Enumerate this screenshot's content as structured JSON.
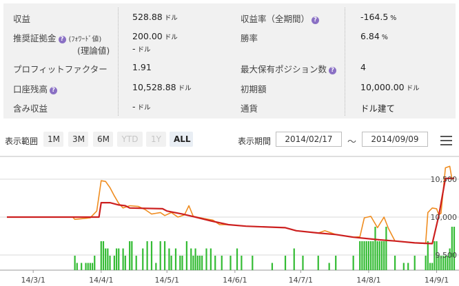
{
  "stats": {
    "rows": [
      {
        "left": {
          "label": "収益",
          "value": "528.88",
          "unit": "ドル"
        },
        "right": {
          "label": "収益率（全期間）",
          "help": true,
          "value": "-164.5",
          "unit": "%"
        }
      },
      {
        "left": {
          "label": "推奨証拠金",
          "help": true,
          "sub1": "(ﾌｫﾜｰﾄﾞ値)",
          "sub2": "(理論値)",
          "value": "200.00",
          "unit": "ドル",
          "value2": "-",
          "unit2": "ドル"
        },
        "right": {
          "label": "勝率",
          "value": "6.84",
          "unit": "%"
        }
      },
      {
        "left": {
          "label": "プロフィットファクター",
          "value": "1.91"
        },
        "right": {
          "label": "最大保有ポジション数",
          "help": true,
          "value": "4"
        }
      },
      {
        "left": {
          "label": "口座残高",
          "help": true,
          "value": "10,528.88",
          "unit": "ドル"
        },
        "right": {
          "label": "初期額",
          "value": "10,000.00",
          "unit": "ドル"
        }
      },
      {
        "left": {
          "label": "含み収益",
          "value": "-",
          "unit": "ドル"
        },
        "right": {
          "label": "通貨",
          "value": "ドル建て"
        }
      }
    ],
    "help_glyph": "?"
  },
  "controls": {
    "range_label": "表示範囲",
    "ranges": [
      {
        "label": "1M",
        "state": "normal"
      },
      {
        "label": "3M",
        "state": "normal"
      },
      {
        "label": "6M",
        "state": "normal"
      },
      {
        "label": "YTD",
        "state": "disabled"
      },
      {
        "label": "1Y",
        "state": "disabled"
      },
      {
        "label": "ALL",
        "state": "active"
      }
    ],
    "period_label": "表示期間",
    "date_from": "2014/02/17",
    "tilde": "〜",
    "date_to": "2014/09/09",
    "menu_icon": "hamburger-menu-icon"
  },
  "chart_data": {
    "type": "line",
    "x_range": [
      "2014-02-17",
      "2014-09-09"
    ],
    "x_ticks": [
      "14/3/1",
      "14/4/1",
      "14/5/1",
      "14/6/1",
      "14/7/1",
      "14/8/1",
      "14/9/1"
    ],
    "y_ticks": [
      {
        "value": 10500,
        "label": "10,500"
      },
      {
        "value": 10000,
        "label": "10,000"
      },
      {
        "value": 9500,
        "label": "9,500"
      }
    ],
    "ylim": [
      9300,
      10800
    ],
    "colors": {
      "balance": "#cc1f1f",
      "equity": "#ef8c1f",
      "volume": "#33bb33",
      "grid": "#d9d9d9"
    },
    "balance": [
      [
        "2014-02-17",
        10000
      ],
      [
        "2014-03-25",
        10000
      ],
      [
        "2014-03-31",
        10000
      ],
      [
        "2014-04-01",
        10190
      ],
      [
        "2014-04-05",
        10190
      ],
      [
        "2014-04-09",
        10160
      ],
      [
        "2014-04-12",
        10150
      ],
      [
        "2014-04-14",
        10120
      ],
      [
        "2014-04-29",
        10110
      ],
      [
        "2014-05-01",
        10080
      ],
      [
        "2014-05-08",
        10040
      ],
      [
        "2014-05-14",
        10000
      ],
      [
        "2014-05-21",
        9950
      ],
      [
        "2014-05-29",
        9900
      ],
      [
        "2014-06-06",
        9880
      ],
      [
        "2014-06-24",
        9860
      ],
      [
        "2014-06-29",
        9820
      ],
      [
        "2014-07-09",
        9790
      ],
      [
        "2014-07-17",
        9770
      ],
      [
        "2014-07-25",
        9735
      ],
      [
        "2014-08-06",
        9700
      ],
      [
        "2014-08-13",
        9685
      ],
      [
        "2014-08-22",
        9660
      ],
      [
        "2014-08-30",
        9650
      ],
      [
        "2014-09-02",
        10020
      ],
      [
        "2014-09-05",
        10510
      ],
      [
        "2014-09-09",
        10510
      ]
    ],
    "equity": [
      [
        "2014-02-17",
        10000
      ],
      [
        "2014-03-19",
        10000
      ],
      [
        "2014-03-20",
        9970
      ],
      [
        "2014-03-27",
        9990
      ],
      [
        "2014-03-30",
        10080
      ],
      [
        "2014-04-01",
        10480
      ],
      [
        "2014-04-03",
        10470
      ],
      [
        "2014-04-05",
        10390
      ],
      [
        "2014-04-07",
        10280
      ],
      [
        "2014-04-09",
        10180
      ],
      [
        "2014-04-11",
        10120
      ],
      [
        "2014-04-14",
        10150
      ],
      [
        "2014-04-18",
        10140
      ],
      [
        "2014-04-21",
        10100
      ],
      [
        "2014-04-24",
        10040
      ],
      [
        "2014-04-26",
        10050
      ],
      [
        "2014-04-28",
        10060
      ],
      [
        "2014-04-30",
        10020
      ],
      [
        "2014-05-03",
        10060
      ],
      [
        "2014-05-06",
        10000
      ],
      [
        "2014-05-09",
        10030
      ],
      [
        "2014-05-11",
        10150
      ],
      [
        "2014-05-13",
        10010
      ],
      [
        "2014-05-18",
        9980
      ],
      [
        "2014-05-22",
        9960
      ],
      [
        "2014-05-25",
        9900
      ],
      [
        "2014-05-29",
        9900
      ],
      [
        "2014-06-06",
        9880
      ],
      [
        "2014-06-24",
        9860
      ],
      [
        "2014-06-29",
        9820
      ],
      [
        "2014-07-09",
        9790
      ],
      [
        "2014-07-12",
        9820
      ],
      [
        "2014-07-17",
        9770
      ],
      [
        "2014-07-25",
        9735
      ],
      [
        "2014-07-28",
        9740
      ],
      [
        "2014-07-30",
        9990
      ],
      [
        "2014-08-02",
        10010
      ],
      [
        "2014-08-05",
        9860
      ],
      [
        "2014-08-08",
        10000
      ],
      [
        "2014-08-10",
        9850
      ],
      [
        "2014-08-13",
        9685
      ],
      [
        "2014-08-22",
        9660
      ],
      [
        "2014-08-27",
        9650
      ],
      [
        "2014-08-28",
        10060
      ],
      [
        "2014-08-30",
        10120
      ],
      [
        "2014-09-01",
        10110
      ],
      [
        "2014-09-02",
        10030
      ],
      [
        "2014-09-03",
        10050
      ],
      [
        "2014-09-05",
        10650
      ],
      [
        "2014-09-07",
        10670
      ],
      [
        "2014-09-08",
        10500
      ],
      [
        "2014-09-09",
        10520
      ]
    ],
    "volume_days": [
      "2014-03-20",
      "2014-03-21",
      "2014-03-23",
      "2014-03-25",
      "2014-03-26",
      "2014-03-27",
      "2014-03-28",
      "2014-03-29",
      "2014-04-01",
      "2014-04-02",
      "2014-04-03",
      "2014-04-04",
      "2014-04-05",
      "2014-04-07",
      "2014-04-08",
      "2014-04-09",
      "2014-04-11",
      "2014-04-12",
      "2014-04-14",
      "2014-04-15",
      "2014-04-17",
      "2014-04-20",
      "2014-04-22",
      "2014-04-24",
      "2014-04-26",
      "2014-04-28",
      "2014-04-30",
      "2014-05-02",
      "2014-05-03",
      "2014-05-05",
      "2014-05-07",
      "2014-05-08",
      "2014-05-10",
      "2014-05-12",
      "2014-05-13",
      "2014-05-14",
      "2014-05-15",
      "2014-05-16",
      "2014-05-17",
      "2014-05-19",
      "2014-05-21",
      "2014-05-23",
      "2014-05-26",
      "2014-05-30",
      "2014-06-02",
      "2014-06-04",
      "2014-06-09",
      "2014-06-18",
      "2014-06-24",
      "2014-06-28",
      "2014-07-02",
      "2014-07-09",
      "2014-07-14",
      "2014-07-17",
      "2014-07-25",
      "2014-07-28",
      "2014-07-29",
      "2014-07-30",
      "2014-07-31",
      "2014-08-01",
      "2014-08-02",
      "2014-08-03",
      "2014-08-04",
      "2014-08-05",
      "2014-08-06",
      "2014-08-07",
      "2014-08-08",
      "2014-08-09",
      "2014-08-13",
      "2014-08-17",
      "2014-08-19",
      "2014-08-22",
      "2014-08-27",
      "2014-08-28",
      "2014-08-29",
      "2014-08-30",
      "2014-08-31",
      "2014-09-01",
      "2014-09-02",
      "2014-09-03",
      "2014-09-04",
      "2014-09-05",
      "2014-09-06",
      "2014-09-07",
      "2014-09-08",
      "2014-09-09"
    ],
    "volume_values": [
      2,
      1,
      1,
      1,
      1,
      1,
      1,
      2,
      4,
      4,
      3,
      3,
      2,
      2,
      3,
      3,
      3,
      2,
      4,
      4,
      2,
      3,
      4,
      4,
      1,
      4,
      4,
      3,
      2,
      3,
      2,
      2,
      4,
      3,
      2,
      3,
      2,
      2,
      2,
      3,
      3,
      2,
      2,
      2,
      3,
      2,
      2,
      1,
      2,
      3,
      2,
      2,
      1,
      2,
      2,
      4,
      4,
      4,
      4,
      4,
      4,
      4,
      6,
      4,
      4,
      4,
      4,
      6,
      2,
      1,
      1,
      2,
      2,
      4,
      1,
      1,
      4,
      4,
      2,
      2,
      2,
      2,
      2,
      3,
      6,
      6
    ]
  }
}
